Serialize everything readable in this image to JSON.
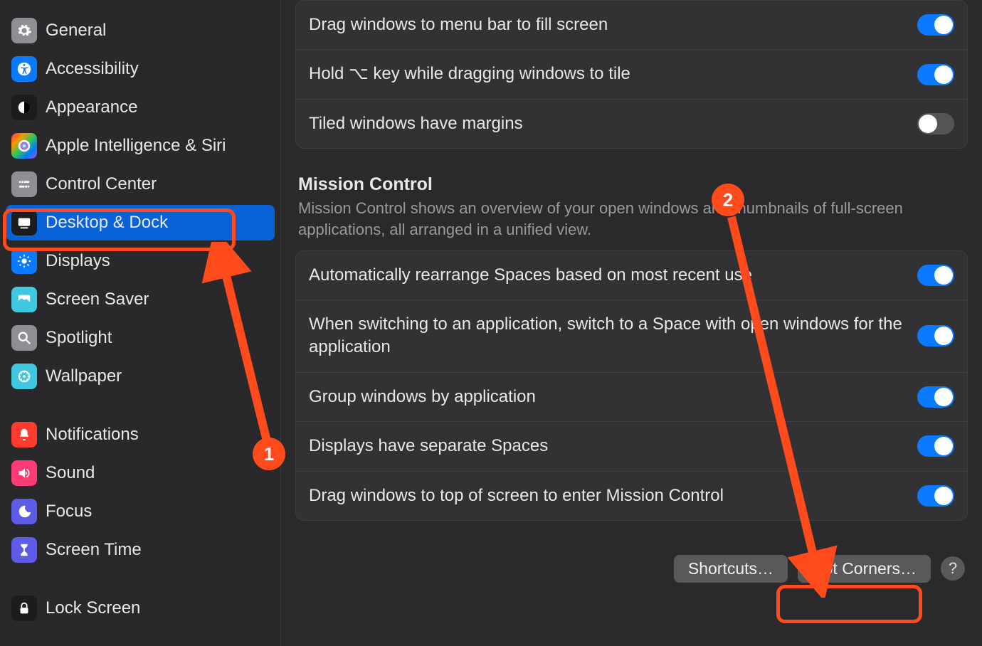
{
  "sidebar": {
    "items": [
      {
        "label": "General",
        "icon": "gear",
        "bg": "#8e8e93"
      },
      {
        "label": "Accessibility",
        "icon": "accessibility",
        "bg": "#0a7aff"
      },
      {
        "label": "Appearance",
        "icon": "appearance",
        "bg": "#1c1c1e"
      },
      {
        "label": "Apple Intelligence & Siri",
        "icon": "siri",
        "bg": "gradient"
      },
      {
        "label": "Control Center",
        "icon": "control-center",
        "bg": "#8e8e93"
      },
      {
        "label": "Desktop & Dock",
        "icon": "dock",
        "bg": "#1c1c1e"
      },
      {
        "label": "Displays",
        "icon": "displays",
        "bg": "#0a7aff"
      },
      {
        "label": "Screen Saver",
        "icon": "screen-saver",
        "bg": "#40c8e0"
      },
      {
        "label": "Spotlight",
        "icon": "search",
        "bg": "#8e8e93"
      },
      {
        "label": "Wallpaper",
        "icon": "wallpaper",
        "bg": "#40c8e0"
      }
    ],
    "items2": [
      {
        "label": "Notifications",
        "icon": "bell",
        "bg": "#ff3b30"
      },
      {
        "label": "Sound",
        "icon": "speaker",
        "bg": "#ff3b77"
      },
      {
        "label": "Focus",
        "icon": "moon",
        "bg": "#5e5ce6"
      },
      {
        "label": "Screen Time",
        "icon": "hourglass",
        "bg": "#5e5ce6"
      }
    ],
    "items3": [
      {
        "label": "Lock Screen",
        "icon": "lock",
        "bg": "#1c1c1e"
      }
    ]
  },
  "window_group": {
    "rows": [
      {
        "label": "Drag windows to menu bar to fill screen",
        "on": true
      },
      {
        "label": "Hold ⌥ key while dragging windows to tile",
        "on": true
      },
      {
        "label": "Tiled windows have margins",
        "on": false
      }
    ]
  },
  "mission": {
    "title": "Mission Control",
    "desc": "Mission Control shows an overview of your open windows and thumbnails of full-screen applications, all arranged in a unified view.",
    "rows": [
      {
        "label": "Automatically rearrange Spaces based on most recent use",
        "on": true
      },
      {
        "label": "When switching to an application, switch to a Space with open windows for the application",
        "on": true
      },
      {
        "label": "Group windows by application",
        "on": true
      },
      {
        "label": "Displays have separate Spaces",
        "on": true
      },
      {
        "label": "Drag windows to top of screen to enter Mission Control",
        "on": true
      }
    ]
  },
  "buttons": {
    "shortcuts": "Shortcuts…",
    "hot_corners": "Hot Corners…",
    "help": "?"
  },
  "annotations": {
    "badge1": "1",
    "badge2": "2"
  }
}
